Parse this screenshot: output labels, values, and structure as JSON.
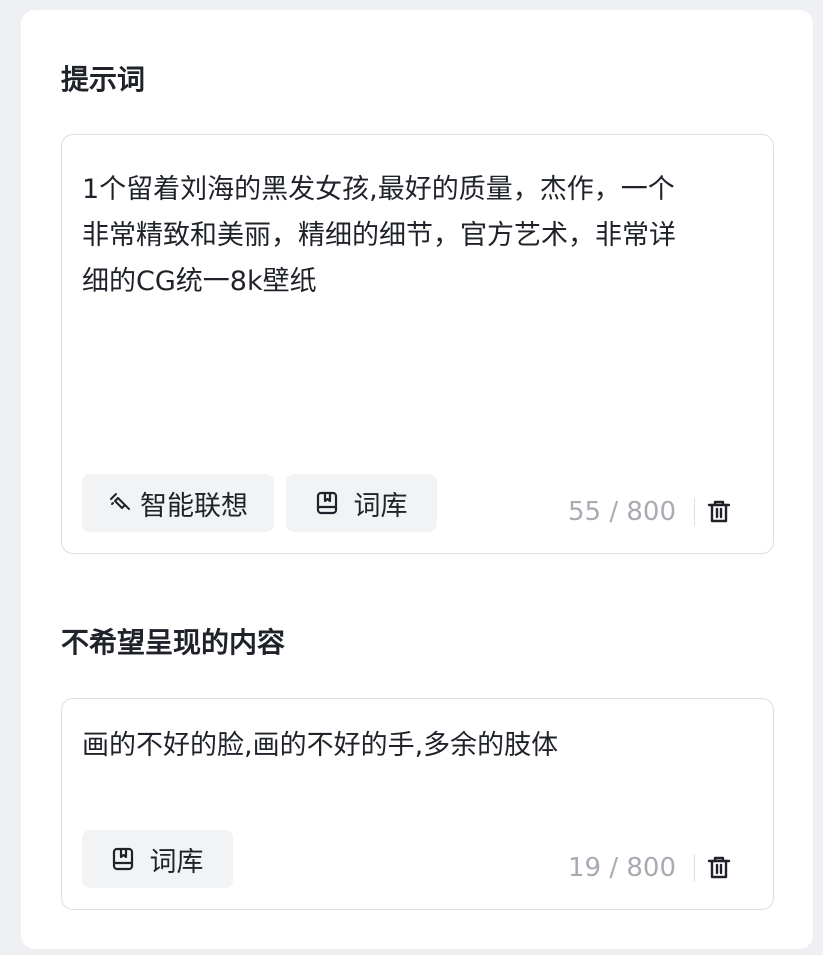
{
  "prompt": {
    "title": "提示词",
    "text": "1个留着刘海的黑发女孩,最好的质量，杰作，一个非常精致和美丽，精细的细节，官方艺术，非常详细的CG统一8k壁纸",
    "assoc_label": "智能联想",
    "library_label": "词库",
    "counter": "55 / 800"
  },
  "negative": {
    "title": "不希望呈现的内容",
    "text": "画的不好的脸,画的不好的手,多余的肢体",
    "library_label": "词库",
    "counter": "19 / 800"
  },
  "icons": {
    "assoc": "magic-wand-icon",
    "library": "book-icon",
    "delete": "trash-icon"
  },
  "colors": {
    "background": "#eef0f4",
    "card": "#ffffff",
    "chip": "#f2f3f5",
    "border": "#dcdfe4",
    "counter": "#a8abb2",
    "text": "#1f2329"
  }
}
